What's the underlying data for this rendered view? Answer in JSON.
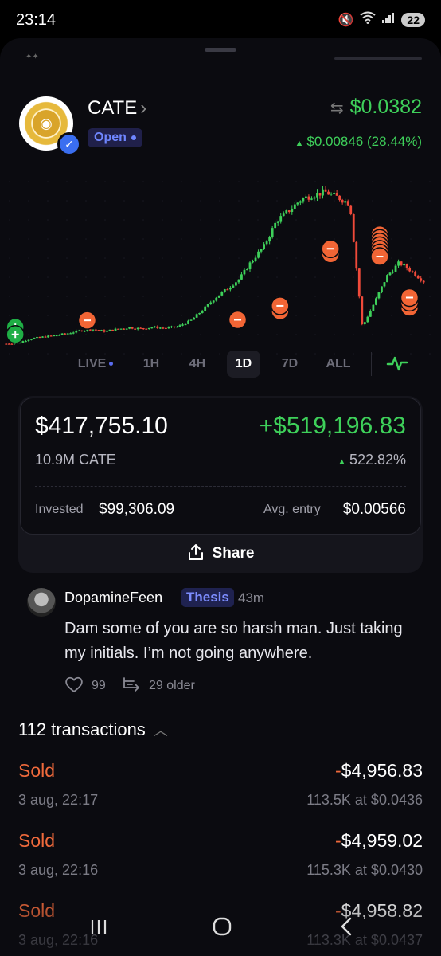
{
  "status_bar": {
    "time": "23:14",
    "battery": "22"
  },
  "token": {
    "name": "CATE",
    "status": "Open",
    "price": "$0.0382",
    "change": "$0.00846 (28.44%)"
  },
  "chart_data": {
    "type": "candlestick",
    "title": "",
    "timeframe": "1D",
    "y_units": "USD",
    "price_path": [
      0.008,
      0.0082,
      0.009,
      0.0093,
      0.0096,
      0.01,
      0.0105,
      0.0108,
      0.0104,
      0.0108,
      0.0111,
      0.0109,
      0.0112,
      0.011,
      0.0113,
      0.0124,
      0.0145,
      0.0168,
      0.0186,
      0.0205,
      0.024,
      0.0268,
      0.0316,
      0.0336,
      0.0358,
      0.0367,
      0.0372,
      0.0362,
      0.035,
      0.0112,
      0.016,
      0.021,
      0.0236,
      0.022,
      0.02
    ],
    "buy_markers": 2,
    "sell_markers": 13,
    "colors": {
      "up": "#3ed05a",
      "down": "#f04a3a",
      "sell": "#f26535",
      "buy": "#1fae45"
    }
  },
  "timeframes": [
    {
      "label": "LIVE",
      "live": true
    },
    {
      "label": "1H"
    },
    {
      "label": "4H"
    },
    {
      "label": "1D",
      "active": true
    },
    {
      "label": "7D"
    },
    {
      "label": "ALL"
    }
  ],
  "position": {
    "value": "$417,755.10",
    "pnl": "+$519,196.83",
    "amount": "10.9M CATE",
    "pnl_pct": "522.82%",
    "invested_label": "Invested",
    "invested": "$99,306.09",
    "avg_label": "Avg. entry",
    "avg_entry": "$0.00566",
    "share_label": "Share"
  },
  "comment": {
    "user": "DopamineFeen",
    "tag": "Thesis",
    "time": "43m",
    "text": "Dam some of you are so harsh man. Just taking my initials. I’m not going anywhere.",
    "likes": "99",
    "older": "29 older"
  },
  "transactions": {
    "header": "112 transactions",
    "items": [
      {
        "type": "Sold",
        "amount": "4,956.83",
        "date": "3 aug, 22:17",
        "detail": "113.5K at $0.0436"
      },
      {
        "type": "Sold",
        "amount": "4,959.02",
        "date": "3 aug, 22:16",
        "detail": "115.3K at $0.0430"
      },
      {
        "type": "Sold",
        "amount": "4,958.82",
        "date": "3 aug, 22:16",
        "detail": "113.3K at $0.0437"
      }
    ]
  }
}
